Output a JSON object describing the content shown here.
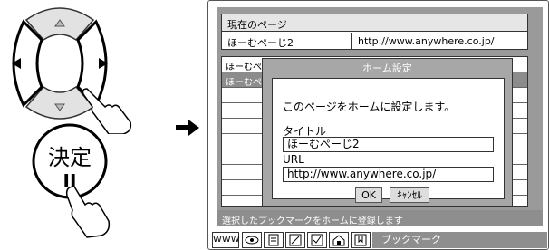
{
  "enter_button": {
    "label": "決定",
    "symbol": "II"
  },
  "screen": {
    "current_page": {
      "heading": "現在のページ",
      "name": "ほーむぺーじ2",
      "url": "http://www.anywhere.co.jp/"
    },
    "bookmark_rows": [
      {
        "text": "ほーむぺ",
        "selected": false
      },
      {
        "text": "ほーむぺ",
        "selected": true
      }
    ],
    "dialog": {
      "title": "ホーム設定",
      "message": "このページをホームに設定します。",
      "title_label": "タイトル",
      "title_value": "ほーむぺーじ2",
      "url_label": "URL",
      "url_value": "http://www.anywhere.co.jp/",
      "ok_label": "OK",
      "cancel_label": "ｷｬﾝｾﾙ"
    },
    "status_text": "選択したブックマークをホームに登録します",
    "toolbar": {
      "www_label": "WWW",
      "icons": [
        "eye-icon",
        "page-icon",
        "edit-icon",
        "check-icon",
        "house-icon",
        "bookmark-icon"
      ],
      "section_label": "ブックマーク"
    }
  }
}
